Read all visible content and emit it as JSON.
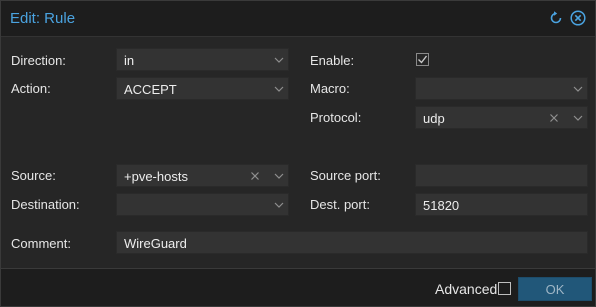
{
  "dialog": {
    "title": "Edit: Rule",
    "accent_color": "#4aa3e0",
    "reset_icon": "reset-icon",
    "close_icon": "close-icon"
  },
  "form": {
    "direction": {
      "label": "Direction:",
      "value": "in"
    },
    "action": {
      "label": "Action:",
      "value": "ACCEPT"
    },
    "enable": {
      "label": "Enable:",
      "checked": true
    },
    "macro": {
      "label": "Macro:",
      "value": ""
    },
    "protocol": {
      "label": "Protocol:",
      "value": "udp"
    },
    "source": {
      "label": "Source:",
      "value": "+pve-hosts"
    },
    "source_port": {
      "label": "Source port:",
      "value": ""
    },
    "destination": {
      "label": "Destination:",
      "value": ""
    },
    "dest_port": {
      "label": "Dest. port:",
      "value": "51820"
    },
    "comment": {
      "label": "Comment:",
      "value": "WireGuard"
    }
  },
  "footer": {
    "advanced_label": "Advanced",
    "advanced_checked": false,
    "ok_label": "OK"
  }
}
